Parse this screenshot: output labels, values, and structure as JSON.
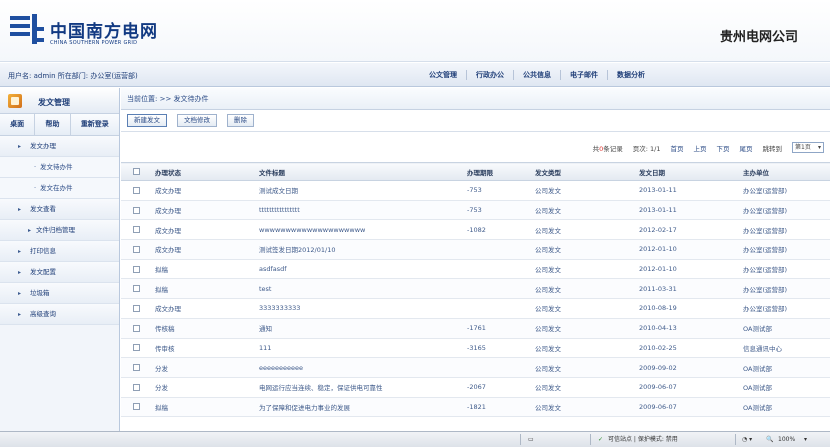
{
  "header": {
    "brand_cn": "中国南方电网",
    "brand_en": "CHINA SOUTHERN POWER GRID",
    "company": "贵州电网公司"
  },
  "topnav": {
    "user_info": "用户名: admin 所在部门: 办公室(运营部)",
    "links": [
      "公文管理",
      "行政办公",
      "公共信息",
      "电子邮件",
      "数据分析"
    ]
  },
  "sidebar": {
    "title": "发文管理",
    "buttons": [
      "桌面",
      "帮助",
      "重新登录"
    ],
    "menu": [
      {
        "label": "发文办理",
        "type": "top"
      },
      {
        "label": "发文待办件",
        "type": "sub"
      },
      {
        "label": "发文在办件",
        "type": "sub"
      },
      {
        "label": "发文查看",
        "type": "top"
      },
      {
        "label": "文件归档管理",
        "type": "wide"
      },
      {
        "label": "打印信息",
        "type": "top"
      },
      {
        "label": "发文配置",
        "type": "top"
      },
      {
        "label": "垃圾箱",
        "type": "top"
      },
      {
        "label": "高级查询",
        "type": "top"
      }
    ]
  },
  "main": {
    "breadcrumb": "当前位置: >> 发文待办件",
    "toolbar": [
      "新建发文",
      "文档修改",
      "删除"
    ],
    "pager": {
      "count_prefix": "共",
      "count_value": "0",
      "count_suffix": "条记录",
      "page_info": "页次: 1/1",
      "first": "首页",
      "prev": "上页",
      "next": "下页",
      "last": "尾页",
      "jump": "跳转到",
      "select": "第1页"
    },
    "columns": [
      "",
      "办理状态",
      "文件标题",
      "办理期限",
      "发文类型",
      "发文日期",
      "主办单位"
    ],
    "rows": [
      [
        "成文办理",
        "测试成文日期",
        "-753",
        "公司发文",
        "2013-01-11",
        "办公室(运营部)"
      ],
      [
        "成文办理",
        "tttttttttttttttt",
        "-753",
        "公司发文",
        "2013-01-11",
        "办公室(运营部)"
      ],
      [
        "成文办理",
        "wwwwwwwwwwwwwwwwwwww",
        "-1082",
        "公司发文",
        "2012-02-17",
        "办公室(运营部)"
      ],
      [
        "成文办理",
        "测试签发日期2012/01/10",
        "",
        "公司发文",
        "2012-01-10",
        "办公室(运营部)"
      ],
      [
        "拟稿",
        "asdfasdf",
        "",
        "公司发文",
        "2012-01-10",
        "办公室(运营部)"
      ],
      [
        "拟稿",
        "test",
        "",
        "公司发文",
        "2011-03-31",
        "办公室(运营部)"
      ],
      [
        "成文办理",
        "3333333333",
        "",
        "公司发文",
        "2010-08-19",
        "办公室(运营部)"
      ],
      [
        "传核稿",
        "通知",
        "-1761",
        "公司发文",
        "2010-04-13",
        "OA测试部"
      ],
      [
        "传审核",
        "111",
        "-3165",
        "公司发文",
        "2010-02-25",
        "信息通讯中心"
      ],
      [
        "分发",
        "eeeeeeeeeee",
        "",
        "公司发文",
        "2009-09-02",
        "OA测试部"
      ],
      [
        "分发",
        "电网运行应当连续、稳定，保证供电可靠性",
        "-2067",
        "公司发文",
        "2009-06-07",
        "OA测试部"
      ],
      [
        "拟稿",
        "为了保障和促进电力事业的发展",
        "-1821",
        "公司发文",
        "2009-06-07",
        "OA测试部"
      ]
    ]
  },
  "statusbar": {
    "trusted": "可信站点 | 保护模式: 禁用",
    "zoom": "100%"
  },
  "colors": {
    "brand_blue": "#1f4fa0",
    "link_blue": "#2b4b86",
    "count_red": "#e0302a"
  }
}
